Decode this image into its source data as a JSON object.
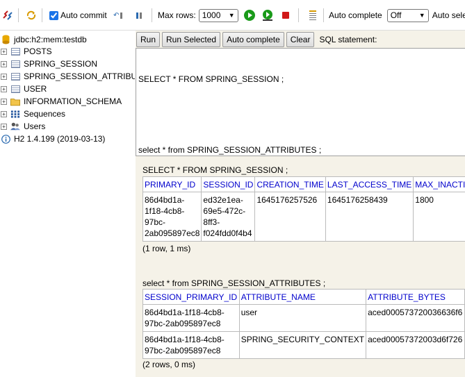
{
  "toolbar": {
    "auto_commit_label": "Auto commit",
    "auto_commit_checked": true,
    "max_rows_label": "Max rows:",
    "max_rows_value": "1000",
    "auto_complete_label": "Auto complete",
    "auto_complete_value": "Off",
    "auto_select_label": "Auto select"
  },
  "tree": {
    "connection": "jdbc:h2:mem:testdb",
    "tables": [
      "POSTS",
      "SPRING_SESSION",
      "SPRING_SESSION_ATTRIBUTES",
      "USER"
    ],
    "schema": "INFORMATION_SCHEMA",
    "sequences": "Sequences",
    "users": "Users",
    "version": "H2 1.4.199 (2019-03-13)"
  },
  "actions": {
    "run": "Run",
    "run_selected": "Run Selected",
    "auto_complete": "Auto complete",
    "clear": "Clear",
    "sql_label": "SQL statement:"
  },
  "editor": {
    "line1": "SELECT * FROM SPRING_SESSION ;",
    "line2": "",
    "line3": "select * from SPRING_SESSION_ATTRIBUTES ;"
  },
  "results": {
    "r1": {
      "query": "SELECT * FROM SPRING_SESSION ;",
      "headers": [
        "PRIMARY_ID",
        "SESSION_ID",
        "CREATION_TIME",
        "LAST_ACCESS_TIME",
        "MAX_INACTIVE_INTERVAL"
      ],
      "row": {
        "primary_id_lines": [
          "86d4bd1a-",
          "1f18-4cb8-",
          "97bc-",
          "2ab095897ec8"
        ],
        "session_id_lines": [
          "ed32e1ea-",
          "69e5-472c-",
          "8ff3-",
          "f024fdd0f4b4"
        ],
        "creation_time": "1645176257526",
        "last_access_time": "1645176258439",
        "max_inactive": "1800"
      },
      "count": "(1 row, 1 ms)"
    },
    "r2": {
      "query": "select * from SPRING_SESSION_ATTRIBUTES ;",
      "headers": [
        "SESSION_PRIMARY_ID",
        "ATTRIBUTE_NAME",
        "ATTRIBUTE_BYTES"
      ],
      "rows": [
        {
          "id_lines": [
            "86d4bd1a-1f18-4cb8-",
            "97bc-2ab095897ec8"
          ],
          "name": "user",
          "bytes": "aced000573720036636f6"
        },
        {
          "id_lines": [
            "86d4bd1a-1f18-4cb8-",
            "97bc-2ab095897ec8"
          ],
          "name": "SPRING_SECURITY_CONTEXT",
          "bytes": "aced00057372003d6f726"
        }
      ],
      "count": "(2 rows, 0 ms)"
    }
  },
  "colors": {
    "header_link": "#0000cc",
    "result_bg": "#f5f2e8",
    "run_green": "#1a9a1a",
    "stop_red": "#d01818"
  }
}
